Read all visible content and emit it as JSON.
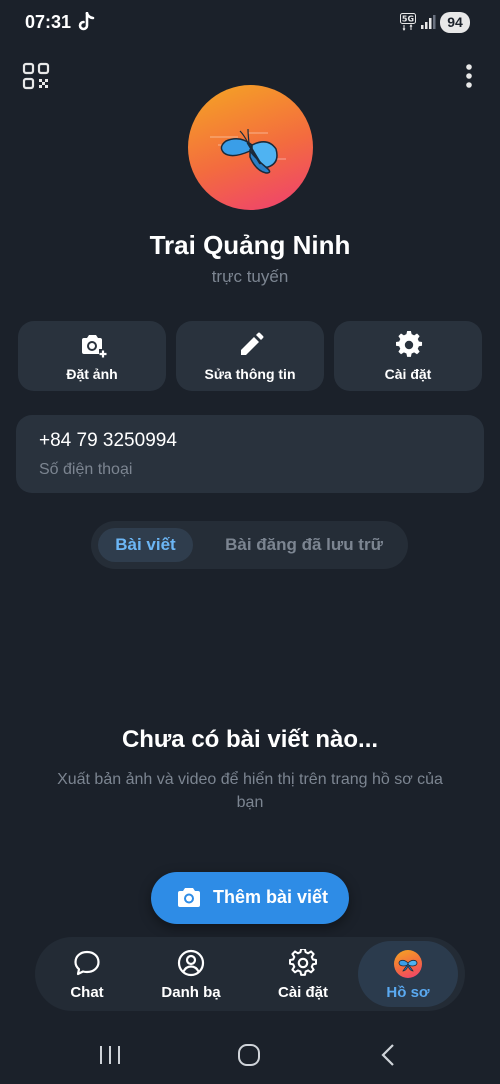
{
  "status_bar": {
    "time": "07:31",
    "network": "5G",
    "battery": "94",
    "icons": [
      "tiktok-icon",
      "network-5g-icon",
      "signal-icon",
      "battery-icon"
    ]
  },
  "header": {
    "icons": [
      "qr-code-icon",
      "more-vertical-icon"
    ]
  },
  "profile": {
    "name": "Trai Quảng Ninh",
    "status": "trực tuyến",
    "avatar_icon": "butterfly-icon",
    "avatar_gradient": [
      "#f5a623",
      "#ef3e72"
    ]
  },
  "actions": [
    {
      "label": "Đặt ảnh",
      "icon": "camera-add-icon"
    },
    {
      "label": "Sửa thông tin",
      "icon": "pencil-icon"
    },
    {
      "label": "Cài đặt",
      "icon": "gear-icon"
    }
  ],
  "phone": {
    "number": "+84 79 3250994",
    "label": "Số điện thoại"
  },
  "tabs": [
    {
      "label": "Bài viết",
      "active": true
    },
    {
      "label": "Bài đăng đã lưu trữ",
      "active": false
    }
  ],
  "empty_state": {
    "title": "Chưa có bài viết nào...",
    "description": "Xuất bản ảnh và video để hiển thị trên trang hồ sơ của bạn"
  },
  "add_post": {
    "label": "Thêm bài viết",
    "icon": "camera-icon"
  },
  "bottom_nav": [
    {
      "label": "Chat",
      "icon": "chat-bubble-icon",
      "active": false
    },
    {
      "label": "Danh bạ",
      "icon": "contacts-icon",
      "active": false
    },
    {
      "label": "Cài đặt",
      "icon": "gear-icon",
      "active": false
    },
    {
      "label": "Hồ sơ",
      "icon": "profile-avatar-icon",
      "active": true
    }
  ],
  "system_nav": {
    "icons": [
      "recent-apps-icon",
      "home-icon",
      "back-icon"
    ]
  },
  "colors": {
    "background": "#1b212a",
    "card": "#29323d",
    "accent": "#2e8ce6",
    "accent_text": "#6cb6f5",
    "muted_text": "#7c8591"
  }
}
